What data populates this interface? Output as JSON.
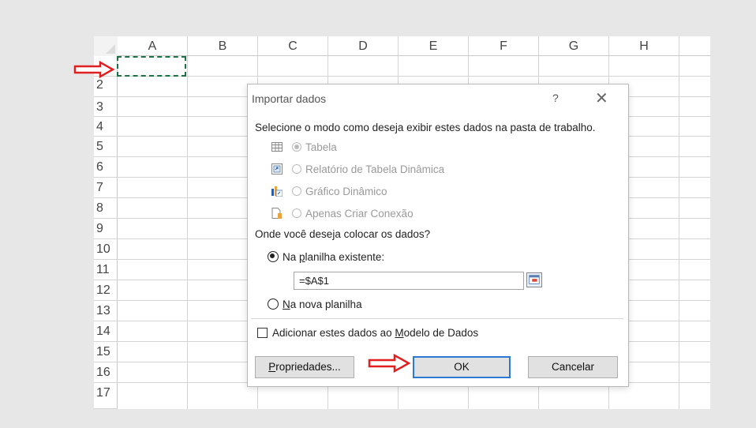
{
  "spreadsheet": {
    "columns": [
      "A",
      "B",
      "C",
      "D",
      "E",
      "F",
      "G",
      "H"
    ],
    "rows": [
      "",
      "2",
      "3",
      "4",
      "5",
      "6",
      "7",
      "8",
      "9",
      "10",
      "11",
      "12",
      "13",
      "14",
      "15",
      "16",
      "17"
    ]
  },
  "dialog": {
    "title": "Importar dados",
    "help": "?",
    "close": "✕",
    "prompt": "Selecione o modo como deseja exibir estes dados na pasta de trabalho.",
    "view_options": [
      {
        "label": "Tabela",
        "icon": "table-icon",
        "selected": true
      },
      {
        "label": "Relatório de Tabela Dinâmica",
        "icon": "pivot-table-icon",
        "selected": false
      },
      {
        "label": "Gráfico Dinâmico",
        "icon": "pivot-chart-icon",
        "selected": false
      },
      {
        "label": "Apenas Criar Conexão",
        "icon": "connection-icon",
        "selected": false
      }
    ],
    "location_prompt": "Onde você deseja colocar os dados?",
    "existing_sheet_pre": "Na ",
    "existing_sheet_u": "p",
    "existing_sheet_post": "lanilha existente:",
    "reference_value": "=$A$1",
    "new_sheet_u": "N",
    "new_sheet_post": "a nova planilha",
    "add_model_pre": "Adicionar estes dados ao ",
    "add_model_u": "M",
    "add_model_post": "odelo de Dados",
    "properties_u": "P",
    "properties_post": "ropriedades...",
    "ok_label": "OK",
    "cancel_label": "Cancelar"
  },
  "colors": {
    "arrow": "#e02020",
    "selection": "#1e7145",
    "ok_border": "#2b79d0"
  }
}
